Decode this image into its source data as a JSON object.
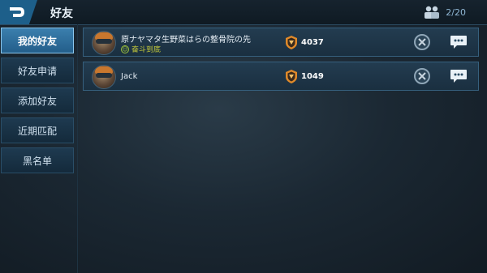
{
  "header": {
    "title": "好友",
    "back_icon": "back-arrow-icon",
    "friends_icon": "friends-group-icon",
    "friend_count": "2/20"
  },
  "sidebar": {
    "items": [
      {
        "label": "我的好友",
        "active": true
      },
      {
        "label": "好友申请",
        "active": false
      },
      {
        "label": "添加好友",
        "active": false
      },
      {
        "label": "近期匹配",
        "active": false
      },
      {
        "label": "黑名单",
        "active": false
      }
    ]
  },
  "friends": [
    {
      "name": "原ナヤマタ生野菜はらの整骨院の先",
      "status": "奋斗到底",
      "score": "4037"
    },
    {
      "name": "Jack",
      "status": "",
      "score": "1049"
    }
  ],
  "colors": {
    "accent": "#3b7fae",
    "status": "#c6cb3a",
    "rank_shield": "#e08a2a"
  }
}
